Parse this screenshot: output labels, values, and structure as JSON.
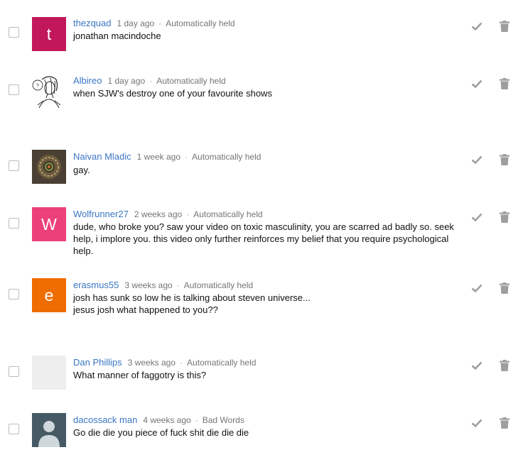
{
  "comments": [
    {
      "author": "thezquad",
      "time": "1 day ago",
      "status": "Automatically held",
      "text": "jonathan macindoche",
      "avatar_letter": "t",
      "avatar_color": "#c2185b",
      "avatar_type": "letter"
    },
    {
      "author": "Albireo",
      "time": "1 day ago",
      "status": "Automatically held",
      "text": "when SJW's destroy one of your favourite shows",
      "avatar_letter": "",
      "avatar_color": "#ffffff",
      "avatar_type": "sketch"
    },
    {
      "author": "Naivan Mladic",
      "time": "1 week ago",
      "status": "Automatically held",
      "text": "gay.",
      "avatar_letter": "",
      "avatar_color": "#5a4a3a",
      "avatar_type": "photo"
    },
    {
      "author": "Wolfrunner27",
      "time": "2 weeks ago",
      "status": "Automatically held",
      "text": "dude, who broke you? saw your video on toxic masculinity, you are scarred ad badly so. seek help, i implore you. this video only further reinforces my belief that you require psychological help.",
      "avatar_letter": "W",
      "avatar_color": "#ec407a",
      "avatar_type": "letter"
    },
    {
      "author": "erasmus55",
      "time": "3 weeks ago",
      "status": "Automatically held",
      "text": "josh has sunk so low he is talking about steven universe...\njesus josh what happened to you??",
      "avatar_letter": "e",
      "avatar_color": "#ef6c00",
      "avatar_type": "letter"
    },
    {
      "author": "Dan Phillips",
      "time": "3 weeks ago",
      "status": "Automatically held",
      "text": "What manner of faggotry is this?",
      "avatar_letter": "",
      "avatar_color": "#eeeeee",
      "avatar_type": "blank"
    },
    {
      "author": "dacossack man",
      "time": "4 weeks ago",
      "status": "Bad Words",
      "text": "Go die die you piece of fuck shit die die die",
      "avatar_letter": "",
      "avatar_color": "#455a64",
      "avatar_type": "person"
    }
  ],
  "icons": {
    "approve": "checkmark-icon",
    "remove": "trash-icon"
  },
  "colors": {
    "author_link": "#3a76c4",
    "meta": "#757575",
    "icon": "#9e9e9e"
  }
}
